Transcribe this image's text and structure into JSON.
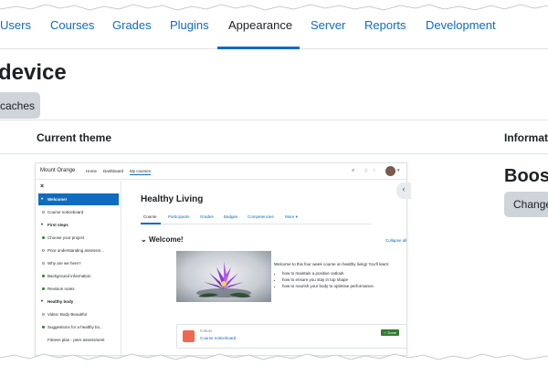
{
  "nav": {
    "tabs": [
      "Users",
      "Courses",
      "Grades",
      "Plugins",
      "Appearance",
      "Server",
      "Reports",
      "Development"
    ],
    "active": "Appearance"
  },
  "page": {
    "title": "device",
    "purge_button": "caches"
  },
  "section": {
    "current_theme_label": "Current theme",
    "info_label": "Informat"
  },
  "theme": {
    "name": "Boos",
    "change_button": "Change"
  },
  "preview": {
    "site_name": "Mount Orange",
    "nav": [
      "Home",
      "Dashboard",
      "My courses"
    ],
    "drawer": {
      "close": "×",
      "items": [
        {
          "label": "Welcome!",
          "kind": "section-selected"
        },
        {
          "label": "Course noticeboard",
          "kind": "activity"
        },
        {
          "label": "First steps",
          "kind": "section"
        },
        {
          "label": "Choose your project",
          "kind": "done"
        },
        {
          "label": "Prior understanding assessm...",
          "kind": "activity"
        },
        {
          "label": "Why are we here?",
          "kind": "activity"
        },
        {
          "label": "Background information",
          "kind": "done"
        },
        {
          "label": "Revision notes",
          "kind": "done"
        },
        {
          "label": "Healthy body",
          "kind": "section"
        },
        {
          "label": "Video: Body Beautiful",
          "kind": "activity"
        },
        {
          "label": "Suggestions for a healthy bo...",
          "kind": "done"
        },
        {
          "label": "Fitness plan - peer assessment",
          "kind": "plain"
        }
      ]
    },
    "course": {
      "title": "Healthy Living",
      "tabs": [
        "Course",
        "Participants",
        "Grades",
        "Badges",
        "Competencies",
        "More ▾"
      ],
      "section_title": "Welcome!",
      "collapse_all": "Collapse all",
      "welcome_text": "Welcome to this four week course on healthy living! You'll learn:",
      "bullets": [
        "how to maintain a positive outlook",
        "how to ensure you stay in top shape",
        "how to nourish your body to optimise performance."
      ],
      "forum": {
        "type": "FORUM",
        "name": "Course noticeboard",
        "status": "✓ Done"
      }
    }
  },
  "colors": {
    "link": "#0f6cbf",
    "text": "#1d2125",
    "button": "#ced4da",
    "success": "#357a32",
    "forum_icon": "#f0684f"
  }
}
